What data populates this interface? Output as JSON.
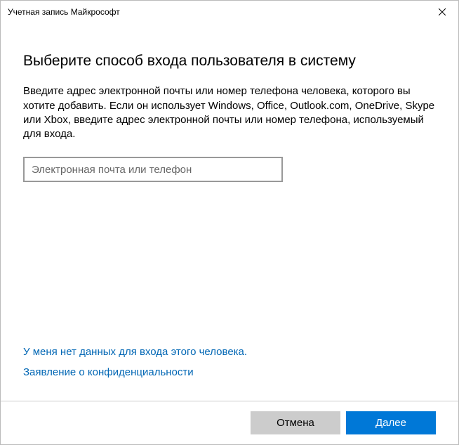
{
  "titlebar": {
    "title": "Учетная запись Майкрософт"
  },
  "main": {
    "heading": "Выберите способ входа пользователя в систему",
    "description": "Введите адрес электронной почты или номер телефона человека, которого вы хотите добавить. Если он использует Windows, Office, Outlook.com, OneDrive, Skype или Xbox, введите адрес электронной почты или номер телефона, используемый для входа.",
    "input": {
      "placeholder": "Электронная почта или телефон",
      "value": ""
    }
  },
  "links": {
    "no_credentials": "У меня нет данных для входа этого человека.",
    "privacy": "Заявление о конфиденциальности"
  },
  "footer": {
    "cancel_label": "Отмена",
    "next_label": "Далее"
  }
}
